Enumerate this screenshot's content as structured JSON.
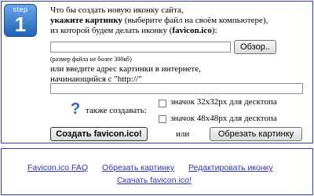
{
  "step": {
    "label": "step",
    "number": "1"
  },
  "instructions": {
    "line1": "Что бы создать новую иконку сайта,",
    "line2_bold": "укажите картинку",
    "line2_rest": " (выберите файл на своём компьютере),",
    "line3_pre": "из которой будем делать иконку (",
    "line3_bold": "favicon.ico",
    "line3_post": "):"
  },
  "file_input": {
    "value": "",
    "browse_label": "Обзор.."
  },
  "size_note": "(размер файла не более 300кб)",
  "url_section": {
    "line1": "или введите адрес картинки в интернете,",
    "line2": "начинающийся с \"http://\"",
    "value": ""
  },
  "options": {
    "help_symbol": "?",
    "also_create_label": "также создавать:",
    "opt1": {
      "label": "значок 32x32px для десктопа",
      "checked": false
    },
    "opt2": {
      "label": "значок 48x48px для десктопа",
      "checked": false
    }
  },
  "actions": {
    "create_label": "Создать favicon.ico!",
    "or_label": "или",
    "crop_label": "Обрезать картинку"
  },
  "links": {
    "faq": "Favicon.ico FAQ",
    "crop": "Обрезать картинку",
    "edit": "Редактировать иконку",
    "download": "Скачать favicon.ico!"
  }
}
